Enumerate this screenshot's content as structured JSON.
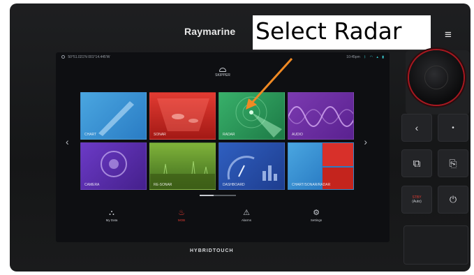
{
  "device": {
    "brand": "Raymarine",
    "footer_logo": "HYBRIDTOUCH"
  },
  "annotation": {
    "callout_text": "Select Radar",
    "arrow_color": "#f08a24"
  },
  "screen": {
    "statusbar": {
      "position": "50°51.021'N  001°14.445'W",
      "time": "10:45pm"
    },
    "profile_label": "SKIPPER",
    "tiles": [
      {
        "label": "CHART"
      },
      {
        "label": "SONAR"
      },
      {
        "label": "RADAR"
      },
      {
        "label": "AUDIO"
      },
      {
        "label": "CAMERA"
      },
      {
        "label": "RE-SONAR"
      },
      {
        "label": "DASHBOARD"
      },
      {
        "label": "CHART/SONAR/RADAR"
      }
    ],
    "dock": [
      {
        "label": "My Data"
      },
      {
        "label": "MOB"
      },
      {
        "label": "Alarms"
      },
      {
        "label": "Settings"
      }
    ]
  },
  "controls": {
    "stby_label": "STBY",
    "stby_sub": "(Auto)"
  },
  "colors": {
    "chart": "#3a93d6",
    "sonar": "#d42b23",
    "radar": "#2e9a5a",
    "audio": "#6a2ea4",
    "mob": "#e23b32"
  }
}
